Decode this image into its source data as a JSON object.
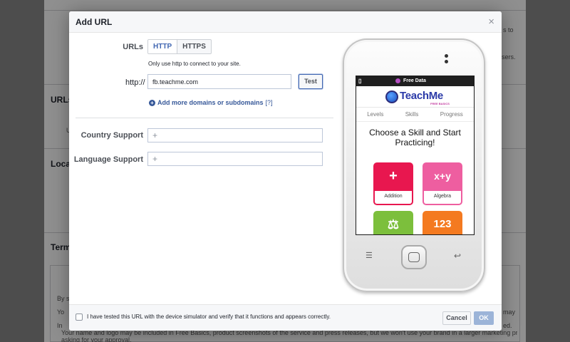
{
  "background": {
    "section_urls": "URLs,",
    "section_local": "Local",
    "section_terms": "Terms",
    "frag_top_right": "s to",
    "frag_right_2": "sers.",
    "frag_left_1": "U",
    "frag_by": "By s",
    "frag_yo": "Yo",
    "frag_in": "In",
    "frag_may": "may",
    "frag_ed": "ed.",
    "terms_line": "Your name and logo may be included in Free Basics, product screenshots of the service and press releases, but we won't use your brand in a larger marketing promotion without first",
    "terms_line_2": "asking for your approval."
  },
  "dialog": {
    "title": "Add URL",
    "close": "×",
    "urls_label": "URLs",
    "protocols": [
      "HTTP",
      "HTTPS"
    ],
    "hint": "Only use http to connect to your site.",
    "protocol_prefix": "http://",
    "url_value": "fb.teachme.com",
    "test_label": "Test",
    "add_more": "Add more domains or subdomains",
    "help": "[?]",
    "country_label": "Country Support",
    "language_label": "Language Support",
    "token_plus": "+",
    "checkbox_label": "I have tested this URL with the device simulator and verify that it functions and appears correctly.",
    "cancel_label": "Cancel",
    "ok_label": "OK"
  },
  "phone": {
    "status_text": "Free Data",
    "logo_text": "TeachMe",
    "logo_sub": "FREE BASICS",
    "nav": [
      "Levels",
      "Skills",
      "Progress"
    ],
    "heading_line1": "Choose a Skill and Start",
    "heading_line2": "Practicing!",
    "tiles": [
      {
        "symbol": "+",
        "label": "Addition",
        "color": "#e8174f"
      },
      {
        "symbol": "x+y",
        "label": "Algebra",
        "color": "#ee5ea0"
      },
      {
        "symbol": "⚖",
        "label": "",
        "color": "#7cbf3c"
      },
      {
        "symbol": "123",
        "label": "",
        "color": "#f47a20"
      }
    ],
    "menu_icon": "☰",
    "back_icon": "↩"
  }
}
